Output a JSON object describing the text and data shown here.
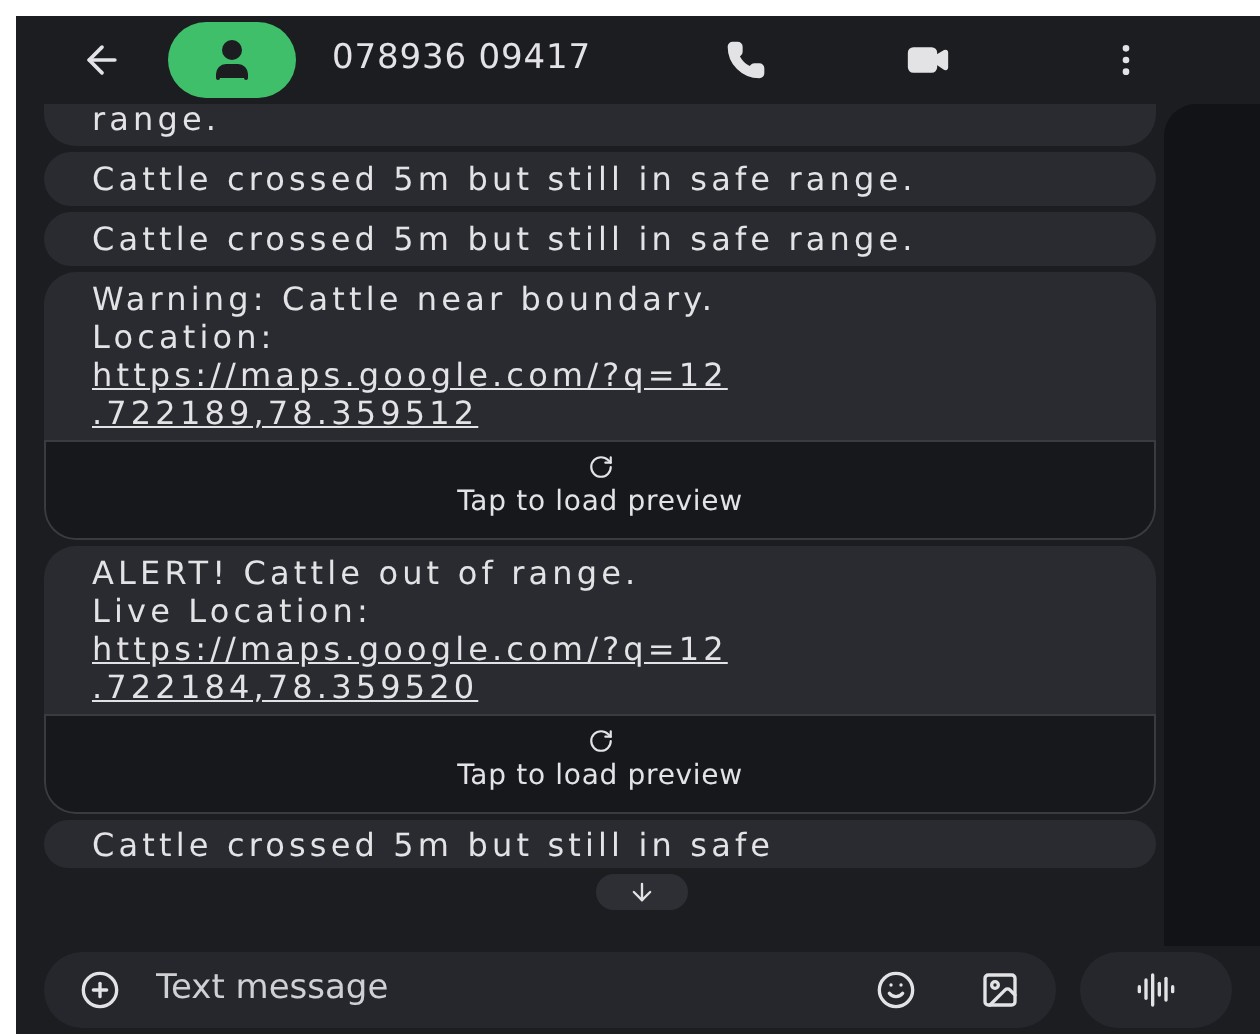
{
  "header": {
    "contact": "078936 09417"
  },
  "messages": [
    {
      "text": "range."
    },
    {
      "text": "Cattle crossed 5m but still in safe range."
    },
    {
      "text": "Cattle crossed 5m but still in safe range."
    },
    {
      "text": "Warning: Cattle near boundary.\nLocation:",
      "link": "https://maps.google.com/?q=12\n.722189,78.359512",
      "preview": "Tap to load preview"
    },
    {
      "text": "ALERT! Cattle out of range.\nLive Location:",
      "link": "https://maps.google.com/?q=12\n.722184,78.359520",
      "preview": "Tap to load preview"
    },
    {
      "text": "Cattle crossed 5m but still in safe"
    }
  ],
  "composer": {
    "placeholder": "Text message"
  }
}
